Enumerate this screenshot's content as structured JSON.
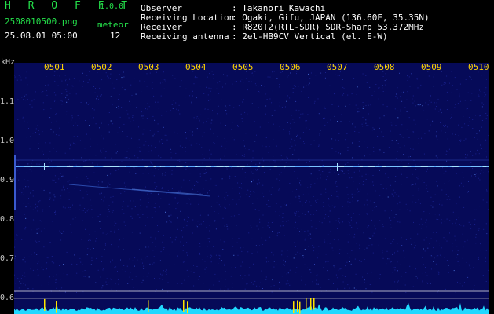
{
  "app": {
    "name": "H R O F F T",
    "version": "1.0.0"
  },
  "file": {
    "name": "2508010500.png",
    "datetime": "25.08.01 05:00"
  },
  "meteor": {
    "label": "meteor",
    "count": "12"
  },
  "info": {
    "observer_label": "Observer",
    "observer_value": ": Takanori Kawachi",
    "location_label": "Receiving Location",
    "location_value": ": Ogaki, Gifu, JAPAN (136.60E, 35.35N)",
    "receiver_label": "Receiver",
    "receiver_value": ": R820T2(RTL-SDR) SDR-Sharp 53.372MHz",
    "antenna_label": "Receiving antenna",
    "antenna_value": ": 2el-HB9CV Vertical (el. E-W)"
  },
  "axis": {
    "y_unit": "kHz",
    "y_ticks": [
      "1.1",
      "1.0",
      "0.9",
      "0.8",
      "0.7",
      "0.6"
    ],
    "x_ticks": [
      "0501",
      "0502",
      "0503",
      "0504",
      "0505",
      "0506",
      "0507",
      "0508",
      "0509",
      "0510"
    ]
  },
  "colors": {
    "background": "#060a58",
    "text_green": "#24e04a",
    "tick_yellow": "#ffd400",
    "carrier": "#8ad8ff",
    "baseline": "#20d8ff"
  }
}
